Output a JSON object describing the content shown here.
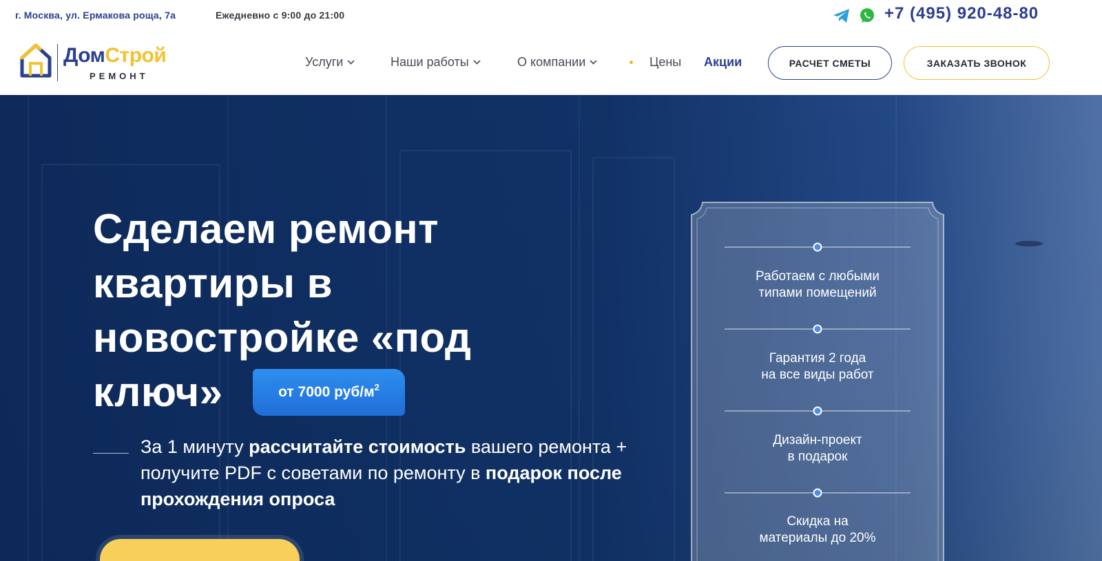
{
  "header": {
    "address": "г. Москва, ул. Ермакова роща, 7а",
    "hours": "Ежедневно с 9:00 до 21:00",
    "phone": "+7 (495) 920-48-80",
    "icons": [
      "telegram-icon",
      "whatsapp-icon",
      "chevron-down-icon"
    ],
    "colors": {
      "brand_blue": "#2a3f8f",
      "brand_yellow": "#f2c230",
      "badge_blue": "#2f8ef0"
    }
  },
  "logo": {
    "name_part1": "Дом",
    "name_part2": "Строй",
    "subtitle": "РЕМОНТ"
  },
  "nav": {
    "items": [
      {
        "label": "Услуги"
      },
      {
        "label": "Наши работы"
      },
      {
        "label": "О компании"
      },
      {
        "label": "Цены"
      },
      {
        "label": "Акции"
      }
    ]
  },
  "buttons": {
    "estimate": "РАСЧЕТ СМЕТЫ",
    "call": "ЗАКАЗАТЬ ЗВОНОК"
  },
  "hero": {
    "title": "Сделаем ремонт квартиры в новостройке «под ключ»",
    "price_text": "от 7000 руб/м",
    "price_sup": "2",
    "lead_part1": "За 1 минуту ",
    "lead_bold1": "рассчитайте стоимость",
    "lead_part2": " вашего ремонта + получите PDF с советами по ремонту в ",
    "lead_bold2": "подарок после прохождения опроса"
  },
  "features": [
    {
      "line1": "Работаем с любыми",
      "line2": "типами помещений"
    },
    {
      "line1": "Гарантия 2 года",
      "line2": "на все виды работ"
    },
    {
      "line1": "Дизайн-проект",
      "line2": "в подарок"
    },
    {
      "line1": "Скидка на",
      "line2": "материалы до 20%"
    }
  ]
}
